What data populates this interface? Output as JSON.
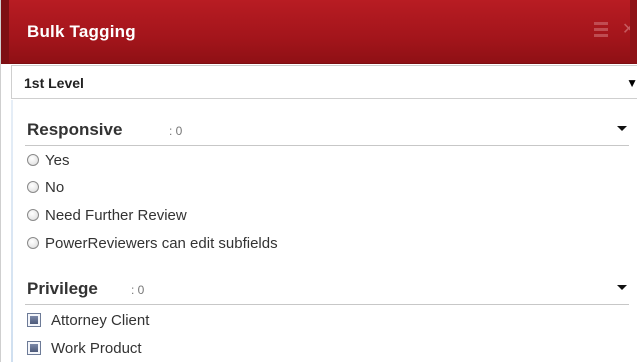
{
  "window": {
    "title": "Bulk Tagging",
    "menu_icon": "hamburger-menu-icon",
    "close_icon": "close-icon"
  },
  "level_select": {
    "selected": "1st Level",
    "arrow_icon": "dropdown-arrow-icon"
  },
  "sections": [
    {
      "name": "Responsive",
      "count": ": 0",
      "toggle_icon": "chevron-down-icon",
      "type": "radio",
      "options": [
        "Yes",
        "No",
        "Need Further Review",
        "PowerReviewers can edit subfields"
      ]
    },
    {
      "name": "Privilege",
      "count": ": 0",
      "toggle_icon": "chevron-down-icon",
      "type": "checkbox",
      "options": [
        "Attorney Client",
        "Work Product"
      ]
    }
  ],
  "colors": {
    "header_red": "#a3151b",
    "header_text": "#ffffff"
  }
}
